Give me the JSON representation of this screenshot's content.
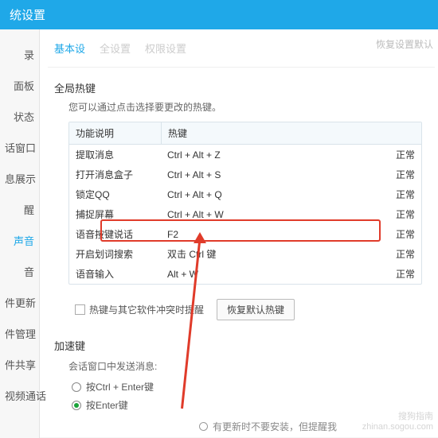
{
  "window": {
    "title": "统设置"
  },
  "top_tabs": [
    "基本设",
    "全设置",
    "权限设置"
  ],
  "corner_label": "恢复设置默认",
  "sidebar": {
    "items": [
      "录",
      "面板",
      "状态",
      "话窗口",
      "息展示",
      "醒",
      "声音",
      "件更新",
      "件管理",
      "件共享",
      "视频通话"
    ]
  },
  "hotkey": {
    "section_title": "全局热键",
    "hint": "您可以通过点击选择要更改的热键。",
    "columns": {
      "func": "功能说明",
      "key": "热键"
    },
    "rows": [
      {
        "func": "提取消息",
        "key": "Ctrl + Alt + Z",
        "status": "正常"
      },
      {
        "func": "打开消息盒子",
        "key": "Ctrl + Alt + S",
        "status": "正常"
      },
      {
        "func": "锁定QQ",
        "key": "Ctrl + Alt + Q",
        "status": "正常"
      },
      {
        "func": "捕捉屏幕",
        "key": "Ctrl + Alt + W",
        "status": "正常"
      },
      {
        "func": "语音按键说话",
        "key": "F2",
        "status": "正常"
      },
      {
        "func": "开启划词搜索",
        "key": "双击 Ctrl 键",
        "status": "正常"
      },
      {
        "func": "语音输入",
        "key": "Alt + W",
        "status": "正常"
      }
    ],
    "conflict_checkbox": "热键与其它软件冲突时提醒",
    "restore_btn": "恢复默认热键"
  },
  "accel": {
    "title": "加速键",
    "subtitle": "会话窗口中发送消息:",
    "options": [
      "按Ctrl + Enter键",
      "按Enter键"
    ],
    "selected": 1
  },
  "footer": {
    "update_opt": "有更新时不要安装，但提醒我"
  },
  "watermark": {
    "l1": "搜狗指南",
    "l2": "zhinan.sogou.com"
  }
}
